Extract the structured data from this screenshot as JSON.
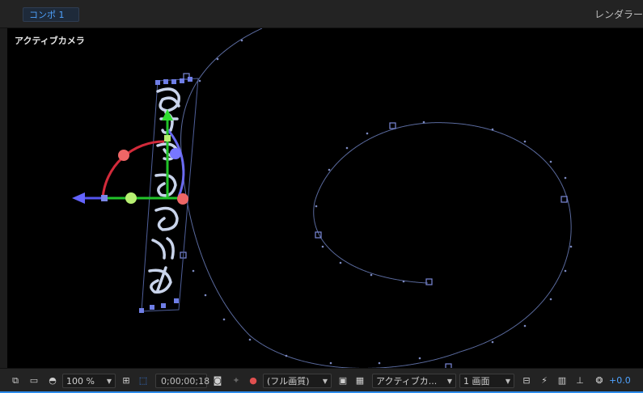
{
  "tabbar": {
    "tab_label": "コンポ 1",
    "render_label": "レンダラー"
  },
  "viewer": {
    "camera_label": "アクティブカメラ",
    "text_layer": "みんなのこころ"
  },
  "toolbar": {
    "zoom": "100 %",
    "timecode": "0;00;00;18",
    "resolution": "(フル画質)",
    "camera_view": "アクティブカ...",
    "layout_view": "1 画面",
    "exposure": "+0.0"
  },
  "icons": [
    "layers-icon",
    "monitor-icon",
    "mask-icon",
    "grid-icon",
    "region-icon",
    "camera-snapshot-icon",
    "show-snapshot-icon",
    "color-channels-icon",
    "fast-preview-icon",
    "transparency-grid-icon",
    "3d-view-icon",
    "draft-icon",
    "flowchart-icon",
    "exposure-icon"
  ],
  "colors": {
    "accent": "#2d8ceb",
    "path": "#6c7aa8",
    "axis_x": "#dd3344",
    "axis_y": "#33cc33",
    "axis_z": "#7777ee"
  }
}
